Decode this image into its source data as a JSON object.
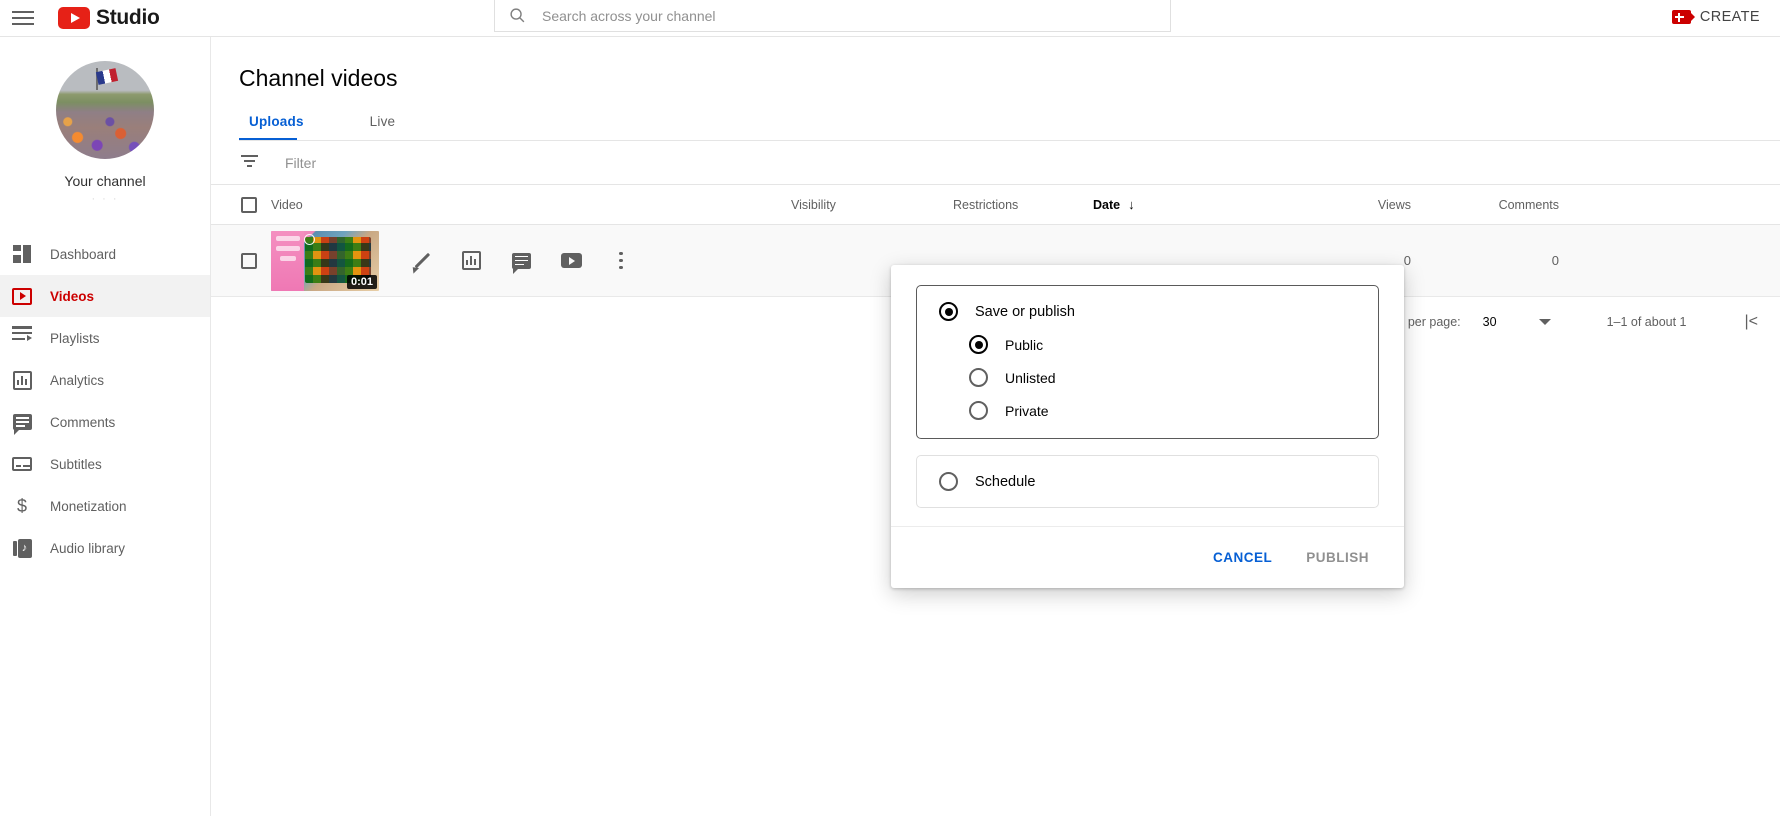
{
  "topbar": {
    "menu_icon": "hamburger-menu-icon",
    "logo_icon": "youtube-play-icon",
    "brand": "Studio",
    "search": {
      "icon": "search-icon",
      "placeholder": "Search across your channel",
      "value": ""
    },
    "create": {
      "icon": "video-camera-plus-icon",
      "label": "CREATE"
    }
  },
  "sidebar": {
    "channel": {
      "avatar_icon": "channel-avatar-image",
      "name": "Your channel",
      "subtext": "· · ·"
    },
    "items": [
      {
        "icon": "dashboard-icon",
        "label": "Dashboard",
        "active": false
      },
      {
        "icon": "videos-icon",
        "label": "Videos",
        "active": true
      },
      {
        "icon": "playlists-icon",
        "label": "Playlists",
        "active": false
      },
      {
        "icon": "analytics-icon",
        "label": "Analytics",
        "active": false
      },
      {
        "icon": "comments-icon",
        "label": "Comments",
        "active": false
      },
      {
        "icon": "subtitles-icon",
        "label": "Subtitles",
        "active": false
      },
      {
        "icon": "monetization-icon",
        "label": "Monetization",
        "active": false
      },
      {
        "icon": "audio-library-icon",
        "label": "Audio library",
        "active": false
      }
    ]
  },
  "main": {
    "title": "Channel videos",
    "tabs": [
      {
        "label": "Uploads",
        "active": true
      },
      {
        "label": "Live",
        "active": false
      }
    ],
    "filter": {
      "icon": "filter-icon",
      "placeholder": "Filter",
      "value": ""
    },
    "table": {
      "columns": {
        "video": "Video",
        "visibility": "Visibility",
        "restrictions": "Restrictions",
        "date": "Date",
        "date_sort_arrow": "↓",
        "views": "Views",
        "comments": "Comments",
        "likes": ""
      },
      "rows": [
        {
          "thumbnail_icon": "video-thumbnail",
          "duration": "0:01",
          "visibility": "",
          "restrictions": "",
          "date": "",
          "views": "0",
          "comments": "0",
          "likes": "",
          "actions": [
            {
              "icon": "edit-pencil-icon"
            },
            {
              "icon": "analytics-bar-icon"
            },
            {
              "icon": "comments-bubble-icon"
            },
            {
              "icon": "youtube-play-icon"
            },
            {
              "icon": "more-options-icon"
            }
          ]
        }
      ]
    },
    "pagination": {
      "rows_per_page_label": "Rows per page:",
      "rows_per_page_value": "30",
      "caret_icon": "chevron-down-icon",
      "range": "1–1 of about 1",
      "first_page_icon": "first-page-icon",
      "first_page_glyph": "|<"
    }
  },
  "dialog": {
    "save_group": {
      "main_option": {
        "label": "Save or publish",
        "selected": true
      },
      "options": [
        {
          "label": "Public",
          "selected": true
        },
        {
          "label": "Unlisted",
          "selected": false
        },
        {
          "label": "Private",
          "selected": false
        }
      ]
    },
    "schedule_group": {
      "option": {
        "label": "Schedule",
        "selected": false
      }
    },
    "buttons": {
      "cancel": "CANCEL",
      "publish": "PUBLISH"
    }
  },
  "colors": {
    "accent_red": "#cc0000",
    "accent_blue": "#065fd4",
    "text_primary": "#030303",
    "text_secondary": "#606060",
    "disabled": "#909090"
  }
}
